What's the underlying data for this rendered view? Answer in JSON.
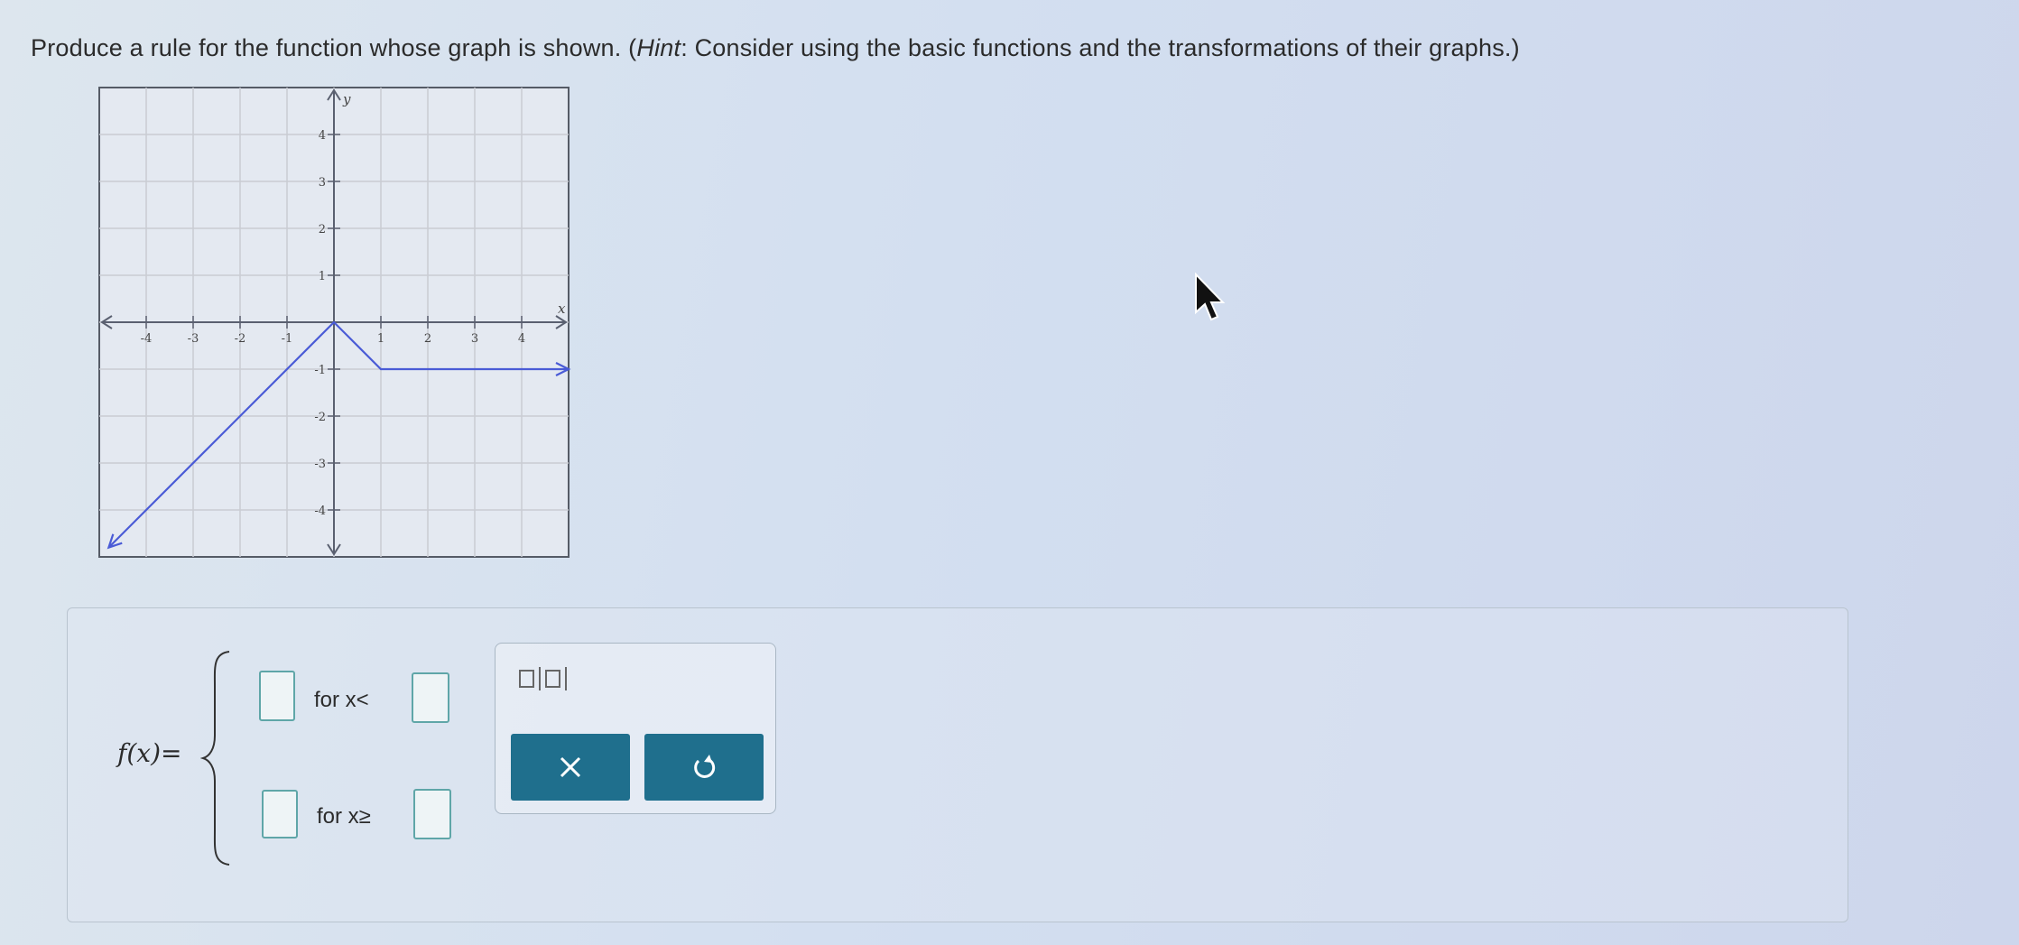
{
  "question": {
    "part1": "Produce a rule for the function whose graph is shown. (",
    "hint_word": "Hint",
    "part2": ": Consider using the basic functions and the transformations of their graphs.)"
  },
  "graph": {
    "x_label": "x",
    "y_label": "y",
    "x_ticks": [
      "-4",
      "-3",
      "-2",
      "-1",
      "1",
      "2",
      "3",
      "4"
    ],
    "y_ticks": [
      "4",
      "3",
      "2",
      "1",
      "-1",
      "-2",
      "-3",
      "-4"
    ],
    "x_range": [
      -5,
      5
    ],
    "y_range": [
      -5,
      5
    ],
    "line_color": "#4a5bd6",
    "curve_points": [
      [
        -4.8,
        -4.8
      ],
      [
        0,
        0
      ],
      [
        1,
        -1
      ],
      [
        5,
        -1
      ]
    ],
    "left_arrow": true,
    "right_arrow": true
  },
  "answer": {
    "function_label": "f(x)=",
    "row1_condition": "for x<",
    "row2_condition": "for x≥",
    "row1_expression": "",
    "row1_bound": "",
    "row2_expression": "",
    "row2_bound": ""
  },
  "toolbox": {
    "template_icon": "piecewise-absolute-template-icon",
    "clear_icon": "close-icon",
    "undo_icon": "undo-icon",
    "button_color": "#1f6f8d"
  }
}
